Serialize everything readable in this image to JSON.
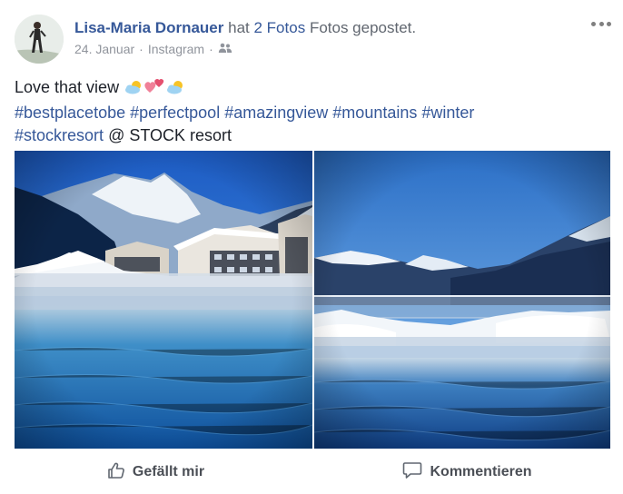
{
  "header": {
    "author": "Lisa-Maria Dornauer",
    "verb": "hat",
    "photo_count_link": "2 Fotos",
    "rest": "Fotos gepostet.",
    "date": "24. Januar",
    "separator": "·",
    "source": "Instagram",
    "separator2": "·",
    "audience_icon": "friends-icon"
  },
  "post": {
    "text": "Love that view",
    "emojis": [
      "sun-behind-cloud-emoji",
      "two-hearts-emoji",
      "sun-behind-cloud-emoji"
    ],
    "hashtags": [
      "#bestplacetobe",
      "#perfectpool",
      "#amazingview",
      "#mountains",
      "#winter",
      "#stockresort"
    ],
    "location_prefix": "@",
    "location": "STOCK resort"
  },
  "photos": [
    {
      "description_icon": "infinity-pool-hotel-photo"
    },
    {
      "description_icon": "infinity-pool-mountain-photo"
    }
  ],
  "actions": {
    "like": "Gefällt mir",
    "comment": "Kommentieren"
  },
  "colors": {
    "link": "#365899",
    "meta": "#90949c",
    "text": "#1d2129",
    "action": "#4b4f56"
  }
}
